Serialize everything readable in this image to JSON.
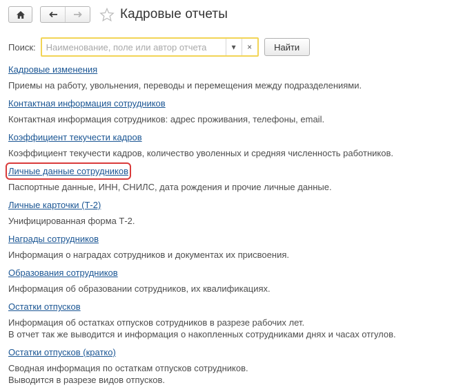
{
  "header": {
    "title": "Кадровые отчеты"
  },
  "search": {
    "label": "Поиск:",
    "placeholder": "Наименование, поле или автор отчета",
    "value": "",
    "dropdown_glyph": "▾",
    "clear_glyph": "×",
    "find_label": "Найти"
  },
  "colors": {
    "link": "#1b5694",
    "search_border": "#f2d455",
    "highlight": "#d93a3a"
  },
  "reports": [
    {
      "title": "Кадровые изменения",
      "desc": "Приемы на работу, увольнения, переводы и перемещения между подразделениями."
    },
    {
      "title": "Контактная информация сотрудников",
      "desc": "Контактная информация сотрудников: адрес проживания, телефоны, email."
    },
    {
      "title": "Коэффициент текучести кадров",
      "desc": "Коэффициент текучести кадров, количество уволенных и средняя численность работников."
    },
    {
      "title": "Личные данные сотрудников",
      "desc": "Паспортные данные, ИНН, СНИЛС, дата рождения и прочие личные данные.",
      "highlighted": true
    },
    {
      "title": "Личные карточки (Т-2)",
      "desc": "Унифицированная форма Т-2."
    },
    {
      "title": "Награды сотрудников",
      "desc": "Информация о наградах сотрудников и документах их присвоения."
    },
    {
      "title": "Образования сотрудников",
      "desc": "Информация об образовании сотрудников, их квалификациях."
    },
    {
      "title": "Остатки отпусков",
      "desc": "Информация об остатках отпусков сотрудников в разрезе рабочих лет.\nВ отчет так же выводится и информация о накопленных сотрудниками днях и часах отгулов."
    },
    {
      "title": "Остатки отпусков (кратко)",
      "desc": "Сводная информация по остаткам отпусков сотрудников.\nВыводится в разрезе видов отпусков."
    }
  ]
}
